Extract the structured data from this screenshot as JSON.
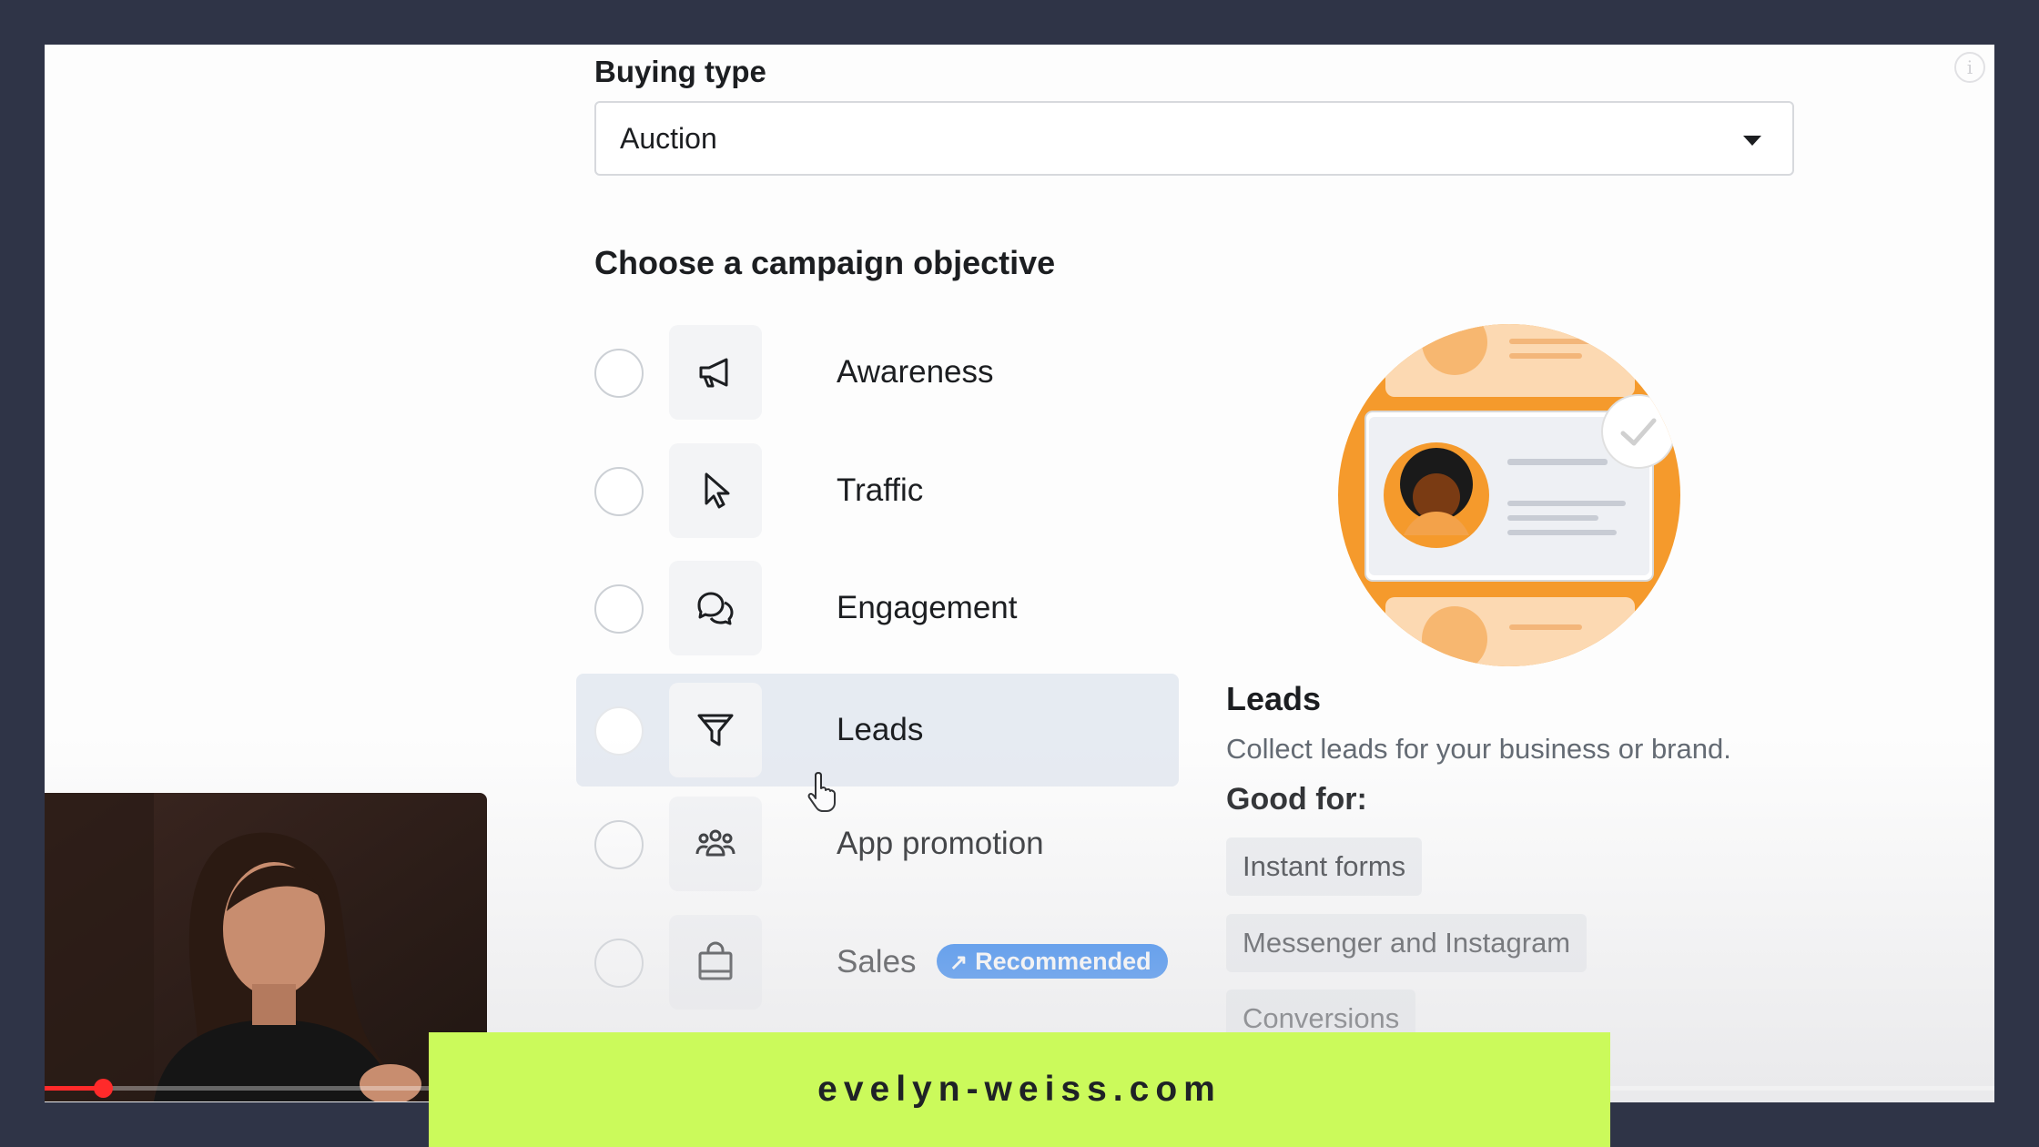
{
  "buying_type": {
    "label": "Buying type",
    "value": "Auction"
  },
  "objective": {
    "heading": "Choose a campaign objective",
    "options": [
      {
        "label": "Awareness",
        "icon": "megaphone-icon"
      },
      {
        "label": "Traffic",
        "icon": "cursor-icon"
      },
      {
        "label": "Engagement",
        "icon": "chat-bubbles-icon"
      },
      {
        "label": "Leads",
        "icon": "funnel-icon",
        "selected": true
      },
      {
        "label": "App promotion",
        "icon": "people-group-icon"
      },
      {
        "label": "Sales",
        "icon": "shopping-bag-icon",
        "badge": "Recommended"
      }
    ]
  },
  "details": {
    "title": "Leads",
    "description": "Collect leads for your business or brand.",
    "good_for_label": "Good for:",
    "good_for": [
      "Instant forms",
      "Messenger and Instagram",
      "Conversions"
    ]
  },
  "video": {
    "progress": 0.03
  },
  "banner": {
    "text": "evelyn-weiss.com"
  },
  "colors": {
    "accent_blue": "#1877f2",
    "banner_green": "#cbfa5b",
    "illustration_orange": "#f59a2c",
    "frame_background": "#2f3447"
  }
}
